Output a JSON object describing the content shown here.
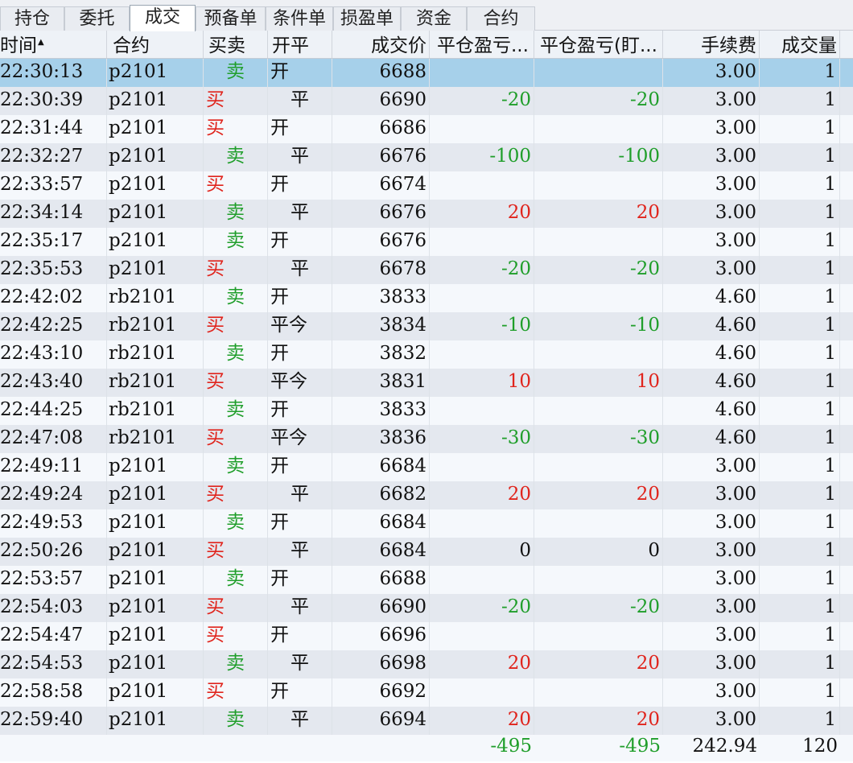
{
  "tabs": [
    {
      "label": "持仓",
      "active": false
    },
    {
      "label": "委托",
      "active": false
    },
    {
      "label": "成交",
      "active": true
    },
    {
      "label": "预备单",
      "active": false
    },
    {
      "label": "条件单",
      "active": false
    },
    {
      "label": "损盈单",
      "active": false
    },
    {
      "label": "资金",
      "active": false
    },
    {
      "label": "合约",
      "active": false
    }
  ],
  "columns": {
    "time": "时间",
    "sort_indicator": "▲",
    "contract": "合约",
    "side": "买卖",
    "openclose": "开平",
    "price": "成交价",
    "pnl": "平仓盈亏...",
    "pnl_mark": "平仓盈亏(盯...",
    "fee": "手续费",
    "volume": "成交量"
  },
  "rows": [
    {
      "time": "22:30:13",
      "contract": "p2101",
      "side": "卖",
      "openclose": "开",
      "price": "6688",
      "pnl": "",
      "pnl_mark": "",
      "fee": "3.00",
      "volume": "1",
      "selected": true
    },
    {
      "time": "22:30:39",
      "contract": "p2101",
      "side": "买",
      "openclose": "平",
      "price": "6690",
      "pnl": "-20",
      "pnl_mark": "-20",
      "fee": "3.00",
      "volume": "1"
    },
    {
      "time": "22:31:44",
      "contract": "p2101",
      "side": "买",
      "openclose": "开",
      "price": "6686",
      "pnl": "",
      "pnl_mark": "",
      "fee": "3.00",
      "volume": "1"
    },
    {
      "time": "22:32:27",
      "contract": "p2101",
      "side": "卖",
      "openclose": "平",
      "price": "6676",
      "pnl": "-100",
      "pnl_mark": "-100",
      "fee": "3.00",
      "volume": "1"
    },
    {
      "time": "22:33:57",
      "contract": "p2101",
      "side": "买",
      "openclose": "开",
      "price": "6674",
      "pnl": "",
      "pnl_mark": "",
      "fee": "3.00",
      "volume": "1"
    },
    {
      "time": "22:34:14",
      "contract": "p2101",
      "side": "卖",
      "openclose": "平",
      "price": "6676",
      "pnl": "20",
      "pnl_mark": "20",
      "fee": "3.00",
      "volume": "1"
    },
    {
      "time": "22:35:17",
      "contract": "p2101",
      "side": "卖",
      "openclose": "开",
      "price": "6676",
      "pnl": "",
      "pnl_mark": "",
      "fee": "3.00",
      "volume": "1"
    },
    {
      "time": "22:35:53",
      "contract": "p2101",
      "side": "买",
      "openclose": "平",
      "price": "6678",
      "pnl": "-20",
      "pnl_mark": "-20",
      "fee": "3.00",
      "volume": "1"
    },
    {
      "time": "22:42:02",
      "contract": "rb2101",
      "side": "卖",
      "openclose": "开",
      "price": "3833",
      "pnl": "",
      "pnl_mark": "",
      "fee": "4.60",
      "volume": "1"
    },
    {
      "time": "22:42:25",
      "contract": "rb2101",
      "side": "买",
      "openclose": "平今",
      "price": "3834",
      "pnl": "-10",
      "pnl_mark": "-10",
      "fee": "4.60",
      "volume": "1"
    },
    {
      "time": "22:43:10",
      "contract": "rb2101",
      "side": "卖",
      "openclose": "开",
      "price": "3832",
      "pnl": "",
      "pnl_mark": "",
      "fee": "4.60",
      "volume": "1"
    },
    {
      "time": "22:43:40",
      "contract": "rb2101",
      "side": "买",
      "openclose": "平今",
      "price": "3831",
      "pnl": "10",
      "pnl_mark": "10",
      "fee": "4.60",
      "volume": "1"
    },
    {
      "time": "22:44:25",
      "contract": "rb2101",
      "side": "卖",
      "openclose": "开",
      "price": "3833",
      "pnl": "",
      "pnl_mark": "",
      "fee": "4.60",
      "volume": "1"
    },
    {
      "time": "22:47:08",
      "contract": "rb2101",
      "side": "买",
      "openclose": "平今",
      "price": "3836",
      "pnl": "-30",
      "pnl_mark": "-30",
      "fee": "4.60",
      "volume": "1"
    },
    {
      "time": "22:49:11",
      "contract": "p2101",
      "side": "卖",
      "openclose": "开",
      "price": "6684",
      "pnl": "",
      "pnl_mark": "",
      "fee": "3.00",
      "volume": "1"
    },
    {
      "time": "22:49:24",
      "contract": "p2101",
      "side": "买",
      "openclose": "平",
      "price": "6682",
      "pnl": "20",
      "pnl_mark": "20",
      "fee": "3.00",
      "volume": "1"
    },
    {
      "time": "22:49:53",
      "contract": "p2101",
      "side": "卖",
      "openclose": "开",
      "price": "6684",
      "pnl": "",
      "pnl_mark": "",
      "fee": "3.00",
      "volume": "1"
    },
    {
      "time": "22:50:26",
      "contract": "p2101",
      "side": "买",
      "openclose": "平",
      "price": "6684",
      "pnl": "0",
      "pnl_mark": "0",
      "fee": "3.00",
      "volume": "1"
    },
    {
      "time": "22:53:57",
      "contract": "p2101",
      "side": "卖",
      "openclose": "开",
      "price": "6688",
      "pnl": "",
      "pnl_mark": "",
      "fee": "3.00",
      "volume": "1"
    },
    {
      "time": "22:54:03",
      "contract": "p2101",
      "side": "买",
      "openclose": "平",
      "price": "6690",
      "pnl": "-20",
      "pnl_mark": "-20",
      "fee": "3.00",
      "volume": "1"
    },
    {
      "time": "22:54:47",
      "contract": "p2101",
      "side": "买",
      "openclose": "开",
      "price": "6696",
      "pnl": "",
      "pnl_mark": "",
      "fee": "3.00",
      "volume": "1"
    },
    {
      "time": "22:54:53",
      "contract": "p2101",
      "side": "卖",
      "openclose": "平",
      "price": "6698",
      "pnl": "20",
      "pnl_mark": "20",
      "fee": "3.00",
      "volume": "1"
    },
    {
      "time": "22:58:58",
      "contract": "p2101",
      "side": "买",
      "openclose": "开",
      "price": "6692",
      "pnl": "",
      "pnl_mark": "",
      "fee": "3.00",
      "volume": "1"
    },
    {
      "time": "22:59:40",
      "contract": "p2101",
      "side": "卖",
      "openclose": "平",
      "price": "6694",
      "pnl": "20",
      "pnl_mark": "20",
      "fee": "3.00",
      "volume": "1"
    }
  ],
  "totals": {
    "pnl": "-495",
    "pnl_mark": "-495",
    "fee": "242.94",
    "volume": "120"
  },
  "colors": {
    "buy": "#e0241c",
    "sell": "#1f9e2a",
    "loss": "#1f9e2a",
    "profit": "#e0241c",
    "selected_row": "#a6d0ea"
  }
}
